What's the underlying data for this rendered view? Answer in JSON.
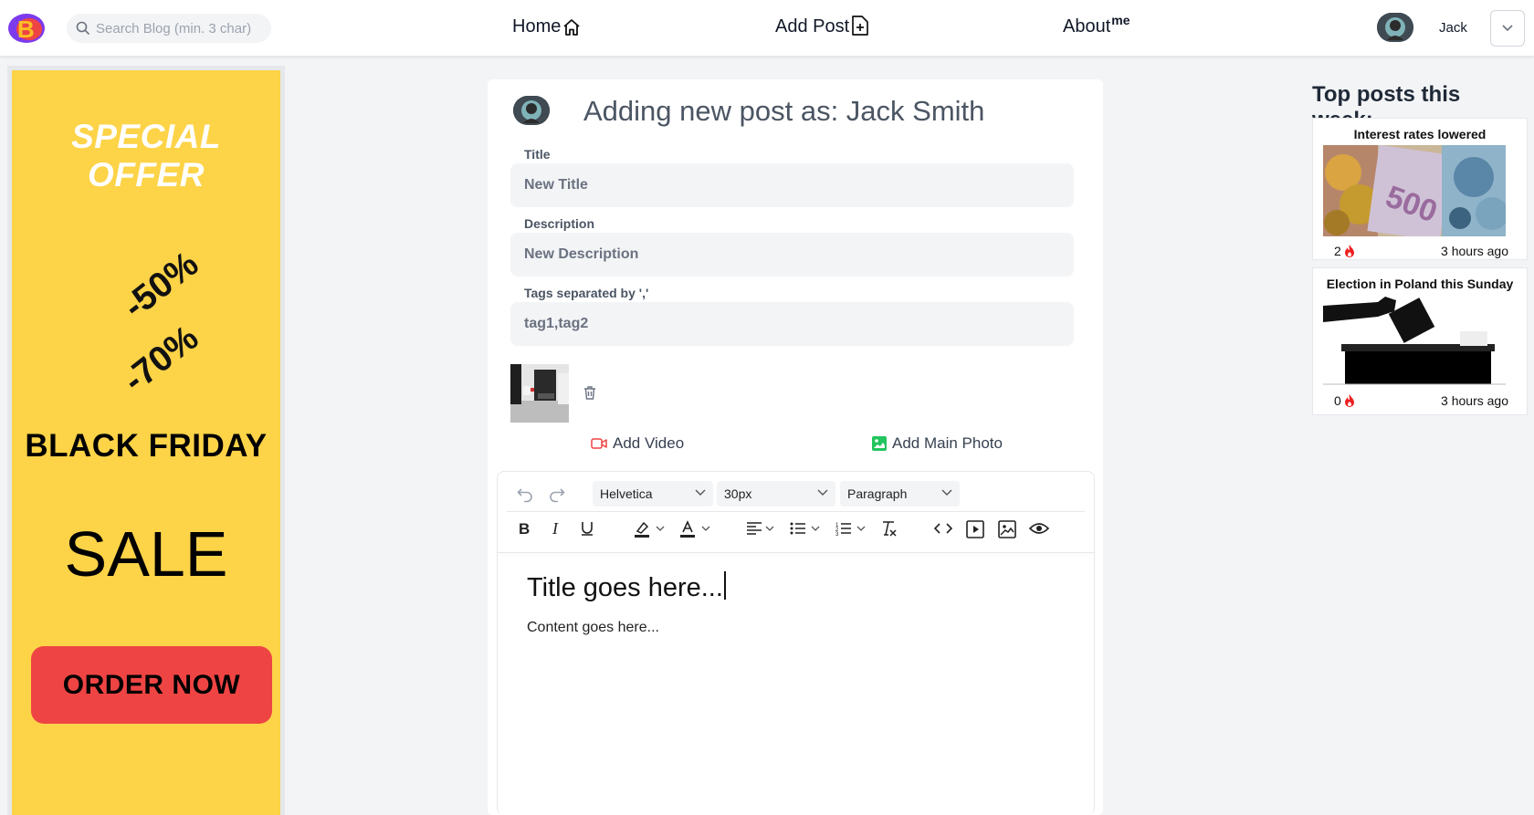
{
  "header": {
    "search_placeholder": "Search Blog (min. 3 char)",
    "nav": {
      "home": "Home",
      "add_post": "Add Post",
      "about": "About",
      "about_sup": "me"
    },
    "user_name": "Jack"
  },
  "ad": {
    "offer": "SPECIAL OFFER",
    "discount1": "-50%",
    "discount2": "-70%",
    "event": "BLACK FRIDAY",
    "sale": "SALE",
    "cta": "ORDER NOW",
    "colors": {
      "background": "#fdd348",
      "cta": "#ef4444"
    }
  },
  "form": {
    "heading": "Adding new post as: Jack Smith",
    "title_label": "Title",
    "title_placeholder": "New Title",
    "description_label": "Description",
    "description_placeholder": "New Description",
    "tags_label": "Tags separated by ','",
    "tags_placeholder": "tag1,tag2",
    "add_video": "Add Video",
    "add_main_photo": "Add Main Photo"
  },
  "editor": {
    "font_family": "Helvetica",
    "font_size": "30px",
    "block_type": "Paragraph",
    "title_text": "Title goes here...",
    "content_text": "Content goes here..."
  },
  "sidebar": {
    "heading": "Top posts this week:",
    "posts": [
      {
        "title": "Interest rates lowered",
        "likes": "2",
        "time": "3 hours ago"
      },
      {
        "title": "Election in Poland this Sunday",
        "likes": "0",
        "time": "3 hours ago"
      }
    ]
  }
}
